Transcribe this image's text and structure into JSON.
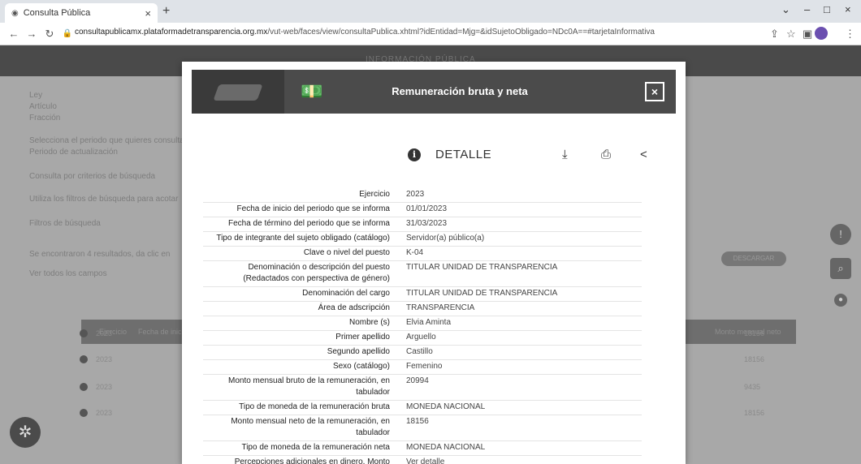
{
  "browser": {
    "tab_title": "Consulta Pública",
    "url_host": "consultapublicamx.plataformadetransparencia.org.mx",
    "url_path": "/vut-web/faces/view/consultaPublica.xhtml?idEntidad=Mjg=&idSujetoObligado=NDc0A==#tarjetaInformativa"
  },
  "background_page": {
    "header_title": "INFORMACIÓN PÚBLICA",
    "left_labels": [
      "Ley",
      "Artículo",
      "Fracción"
    ],
    "period_text": "Selecciona el periodo que quieres consultar",
    "period_label": "Periodo de actualización",
    "filter_hint": "Consulta por criterios de búsqueda",
    "filter_hint2": "Utiliza los filtros de búsqueda para acotar",
    "filters_label": "Filtros de búsqueda",
    "results_text": "Se encontraron 4 resultados, da clic en",
    "all_fields": "Ver todos los campos",
    "table_headers": [
      "Ejercicio",
      "Fecha de inicio",
      "Monto mensual neto"
    ],
    "rows": [
      {
        "year": "2023",
        "amount": "18156"
      },
      {
        "year": "2023",
        "amount": "18156"
      },
      {
        "year": "2023",
        "amount": "9435"
      },
      {
        "year": "2023",
        "amount": "18156"
      }
    ],
    "descargar_btn": "DESCARGAR"
  },
  "modal": {
    "title": "Remuneración bruta y neta",
    "close_label": "×",
    "detail_title": "DETALLE",
    "rows": [
      {
        "label": "Ejercicio",
        "value": "2023"
      },
      {
        "label": "Fecha de inicio del periodo que se informa",
        "value": "01/01/2023"
      },
      {
        "label": "Fecha de término del periodo que se informa",
        "value": "31/03/2023"
      },
      {
        "label": "Tipo de integrante del sujeto obligado (catálogo)",
        "value": "Servidor(a) público(a)"
      },
      {
        "label": "Clave o nivel del puesto",
        "value": "K-04"
      },
      {
        "label": "Denominación o descripción del puesto (Redactados con perspectiva de género)",
        "value": "TITULAR UNIDAD DE TRANSPARENCIA"
      },
      {
        "label": "Denominación del cargo",
        "value": "TITULAR UNIDAD DE TRANSPARENCIA"
      },
      {
        "label": "Área de adscripción",
        "value": "TRANSPARENCIA"
      },
      {
        "label": "Nombre (s)",
        "value": "Elvia Aminta"
      },
      {
        "label": "Primer apellido",
        "value": "Arguello"
      },
      {
        "label": "Segundo apellido",
        "value": "Castillo"
      },
      {
        "label": "Sexo (catálogo)",
        "value": "Femenino"
      },
      {
        "label": "Monto mensual bruto de la remuneración, en tabulador",
        "value": "20994"
      },
      {
        "label": "Tipo de moneda de la remuneración bruta",
        "value": "MONEDA NACIONAL"
      },
      {
        "label": "Monto mensual neto de la remuneración, en tabulador",
        "value": "18156"
      },
      {
        "label": "Tipo de moneda de la remuneración neta",
        "value": "MONEDA NACIONAL"
      },
      {
        "label": "Percepciones adicionales en dinero, Monto",
        "value": "Ver detalle"
      }
    ]
  }
}
